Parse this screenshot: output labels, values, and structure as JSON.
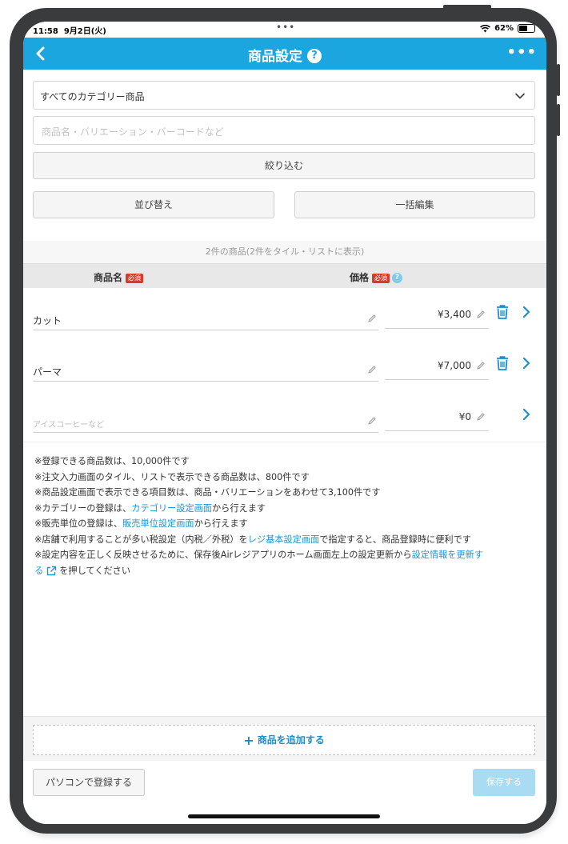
{
  "status_bar": {
    "time": "11:58",
    "date": "9月2日(火)",
    "dots": "•••",
    "battery": "62%",
    "battery_level": 0.62
  },
  "nav": {
    "title": "商品設定",
    "help": "?",
    "back_icon": "chevron-left-icon",
    "more": "•••"
  },
  "category_select": {
    "value": "すべてのカテゴリー商品"
  },
  "search": {
    "placeholder": "商品名・バリエーション・バーコードなど"
  },
  "buttons": {
    "filter": "絞り込む",
    "sort": "並び替え",
    "bulk_edit": "一括編集"
  },
  "count_text": "2件の商品(2件をタイル・リストに表示)",
  "table": {
    "header_name": "商品名",
    "header_price": "価格",
    "required_badge": "必須",
    "header_help": "?",
    "rows": [
      {
        "name": "カット",
        "price": "¥3,400",
        "deletable": true
      },
      {
        "name": "パーマ",
        "price": "¥7,000",
        "deletable": true
      },
      {
        "name_placeholder": "アイスコーヒーなど",
        "price": "¥0",
        "deletable": false
      }
    ]
  },
  "notes": {
    "n1": "※登録できる商品数は、10,000件です",
    "n2": "※注文入力画面のタイル、リストで表示できる商品数は、800件です",
    "n3": "※商品設定画面で表示できる項目数は、商品・バリエーションをあわせて3,100件です",
    "n4_pre": "※カテゴリーの登録は、",
    "n4_link": "カテゴリー設定画面",
    "n4_post": "から行えます",
    "n5_pre": "※販売単位の登録は、",
    "n5_link": "販売単位設定画面",
    "n5_post": "から行えます",
    "n6_pre": "※店舗で利用することが多い税設定（内税／外税）を",
    "n6_link": "レジ基本設定画面",
    "n6_post": "で指定すると、商品登録時に便利です",
    "n7_pre": "※設定内容を正しく反映させるために、保存後Airレジアプリのホーム画面左上の設定更新から",
    "n7_link_a": "設定情報を更新す",
    "n7_link_b": "る",
    "n7_post": "を押してください"
  },
  "add_button": {
    "plus": "+",
    "label": "商品を追加する"
  },
  "footer": {
    "pc_register": "パソコンで登録する",
    "save": "保存する"
  },
  "colors": {
    "accent": "#1ca6e0",
    "link": "#1b95d3",
    "required": "#d63a2b",
    "save_disabled": "#a9dcf2"
  }
}
